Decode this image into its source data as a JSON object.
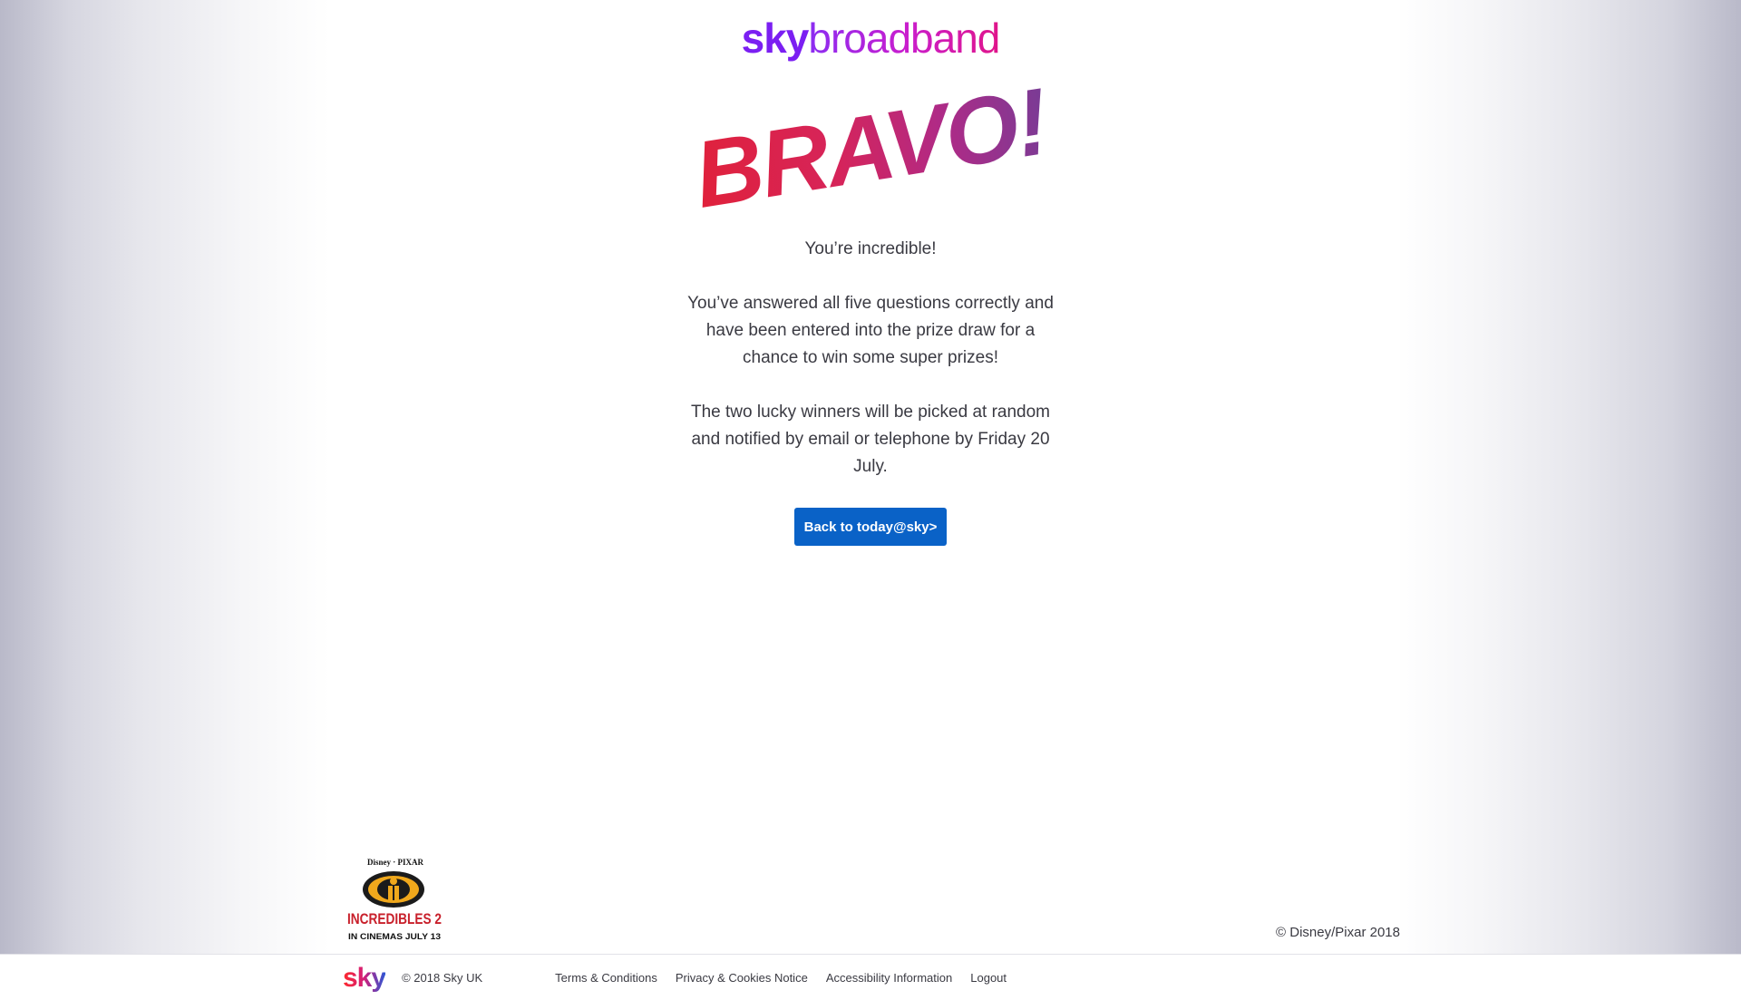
{
  "header": {
    "logo_sky": "sky",
    "logo_product": "broadband"
  },
  "hero": {
    "title": "BRAVO!"
  },
  "message": {
    "line1": "You’re incredible!",
    "line2": "You’ve answered all five questions correctly and have been entered into the prize draw for a chance to win some super prizes!",
    "line3": "The two lucky winners will be picked at random and notified by email or telephone by Friday 20 July."
  },
  "cta": {
    "label": "Back to today@sky>"
  },
  "promo": {
    "brand": "Disney · PIXAR",
    "title": "INCREDIBLES 2",
    "subtitle": "IN CINEMAS JULY 13"
  },
  "disney_copyright": "© Disney/Pixar 2018",
  "footer": {
    "logo": "sky",
    "copyright": "© 2018 Sky UK",
    "links": [
      "Terms & Conditions",
      "Privacy & Cookies Notice",
      "Accessibility Information",
      "Logout"
    ]
  },
  "colors": {
    "button_bg": "#0a62c7",
    "text": "#3a3a42",
    "brand_purple": "#7b1ff2",
    "bravo_red": "#e0213b",
    "bravo_purple": "#7a3b95"
  }
}
